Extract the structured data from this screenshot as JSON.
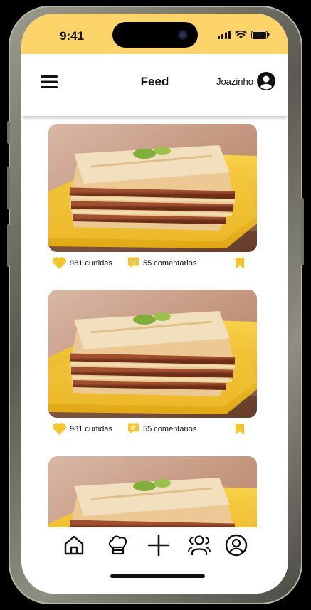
{
  "status_bar": {
    "time": "9:41",
    "icons": [
      "cellular-signal-icon",
      "wifi-icon",
      "battery-icon"
    ]
  },
  "header": {
    "menu_icon": "hamburger-menu-icon",
    "title": "Feed",
    "username": "Joazinho",
    "avatar_icon": "user-circle-icon"
  },
  "posts": [
    {
      "image": "lasagna-photo",
      "likes": "981 curtidas",
      "comments": "55 comentarios"
    },
    {
      "image": "lasagna-photo",
      "likes": "981 curtidas",
      "comments": "55 comentarios"
    },
    {
      "image": "lasagna-photo",
      "likes": "",
      "comments": ""
    }
  ],
  "tab_bar": {
    "items": [
      "home-icon",
      "chef-hat-icon",
      "plus-icon",
      "users-icon",
      "profile-icon"
    ]
  },
  "colors": {
    "accent": "#fdd46a",
    "icon_yellow": "#f6c42e",
    "text": "#111111",
    "background": "#ffffff",
    "phone_bezel": "#000000"
  }
}
